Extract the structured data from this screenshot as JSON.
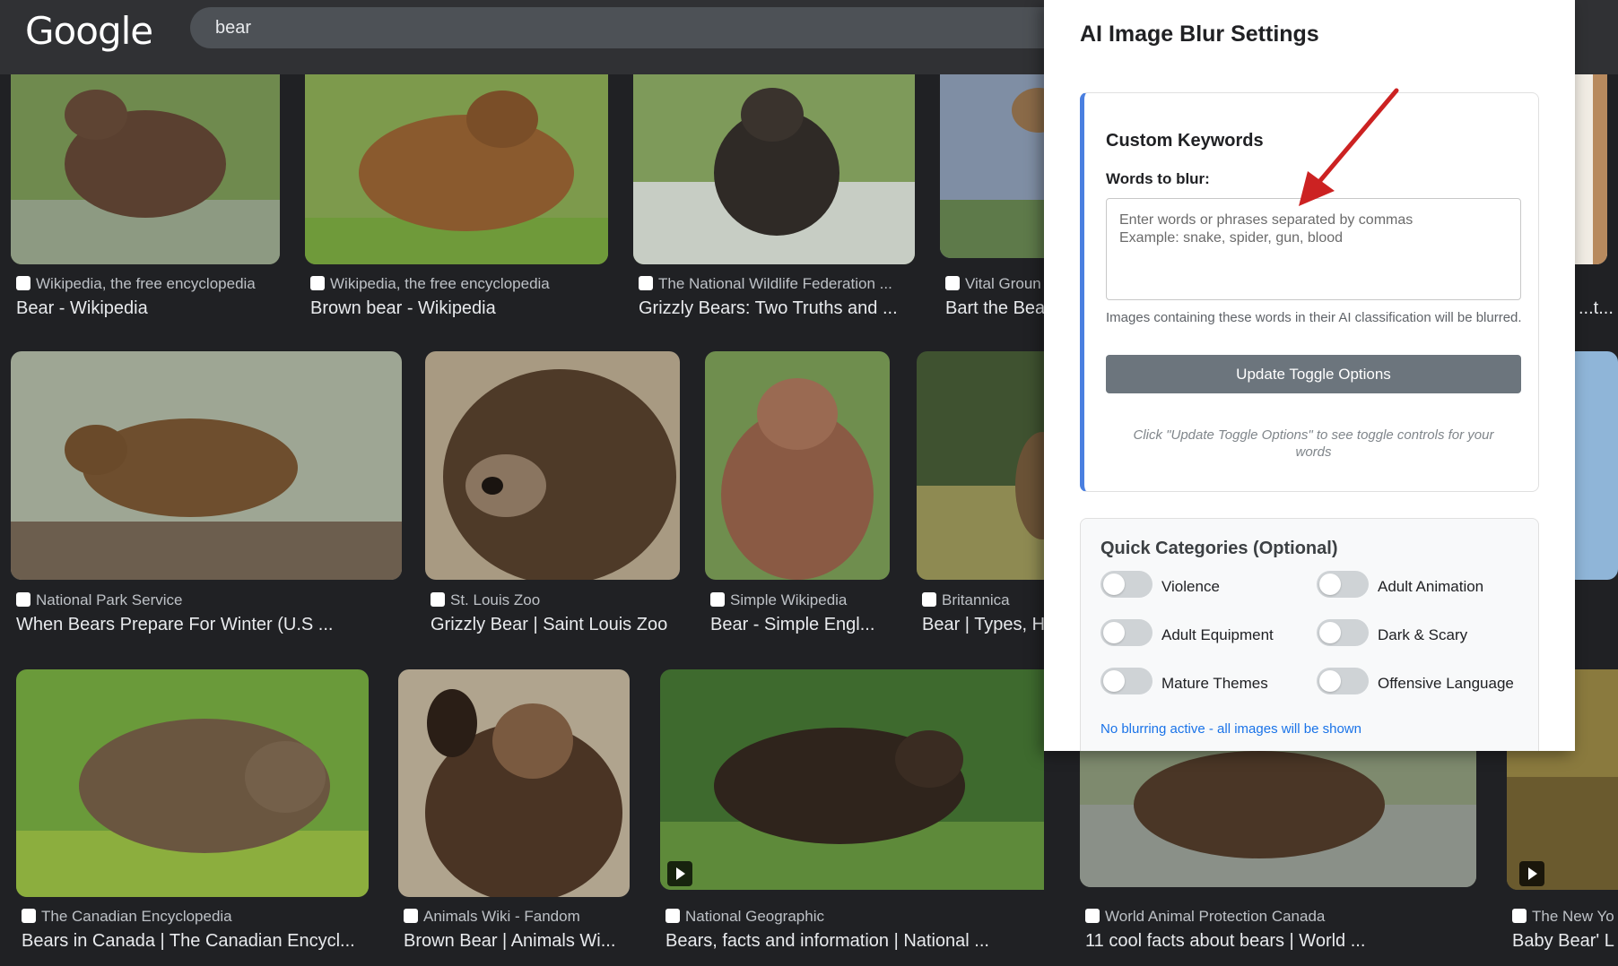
{
  "header": {
    "logo": "Google",
    "search_value": "bear"
  },
  "results": [
    {
      "source": "Wikipedia, the free encyclopedia",
      "title": "Bear - Wikipedia"
    },
    {
      "source": "Wikipedia, the free encyclopedia",
      "title": "Brown bear - Wikipedia"
    },
    {
      "source": "The National Wildlife Federation ...",
      "title": "Grizzly Bears: Two Truths and ..."
    },
    {
      "source": "Vital Groun",
      "title": "Bart the Bea"
    },
    {
      "source": "",
      "title": "...t..."
    },
    {
      "source": "National Park Service",
      "title": "When Bears Prepare For Winter (U.S ..."
    },
    {
      "source": "St. Louis Zoo",
      "title": "Grizzly Bear | Saint Louis Zoo"
    },
    {
      "source": "Simple Wikipedia",
      "title": "Bear - Simple Engl..."
    },
    {
      "source": "Britannica",
      "title": "Bear | Types, H"
    },
    {
      "source": "The Canadian Encyclopedia",
      "title": "Bears in Canada | The Canadian Encycl..."
    },
    {
      "source": "Animals Wiki - Fandom",
      "title": "Brown Bear | Animals Wi..."
    },
    {
      "source": "National Geographic",
      "title": "Bears, facts and information | National ..."
    },
    {
      "source": "World Animal Protection Canada",
      "title": "11 cool facts about bears | World ..."
    },
    {
      "source": "The New Yo",
      "title": "Baby Bear' L"
    }
  ],
  "panel": {
    "title": "AI Image Blur Settings",
    "keywords": {
      "heading": "Custom Keywords",
      "label": "Words to blur:",
      "placeholder": "Enter words or phrases separated by commas\nExample: snake, spider, gun, blood",
      "value": "",
      "help": "Images containing these words in their AI classification will be blurred.",
      "button": "Update Toggle Options",
      "note": "Click \"Update Toggle Options\" to see toggle controls for your words"
    },
    "quick_categories": {
      "heading": "Quick Categories (Optional)",
      "items": [
        {
          "label": "Violence",
          "on": false
        },
        {
          "label": "Adult Animation",
          "on": false
        },
        {
          "label": "Adult Equipment",
          "on": false
        },
        {
          "label": "Dark & Scary",
          "on": false
        },
        {
          "label": "Mature Themes",
          "on": false
        },
        {
          "label": "Offensive Language",
          "on": false
        }
      ],
      "status": "No blurring active - all images will be shown"
    }
  },
  "colors": {
    "accent": "#4a7fe0",
    "button": "#6c757d",
    "status_link": "#1a73e8",
    "arrow": "#cc2222"
  }
}
